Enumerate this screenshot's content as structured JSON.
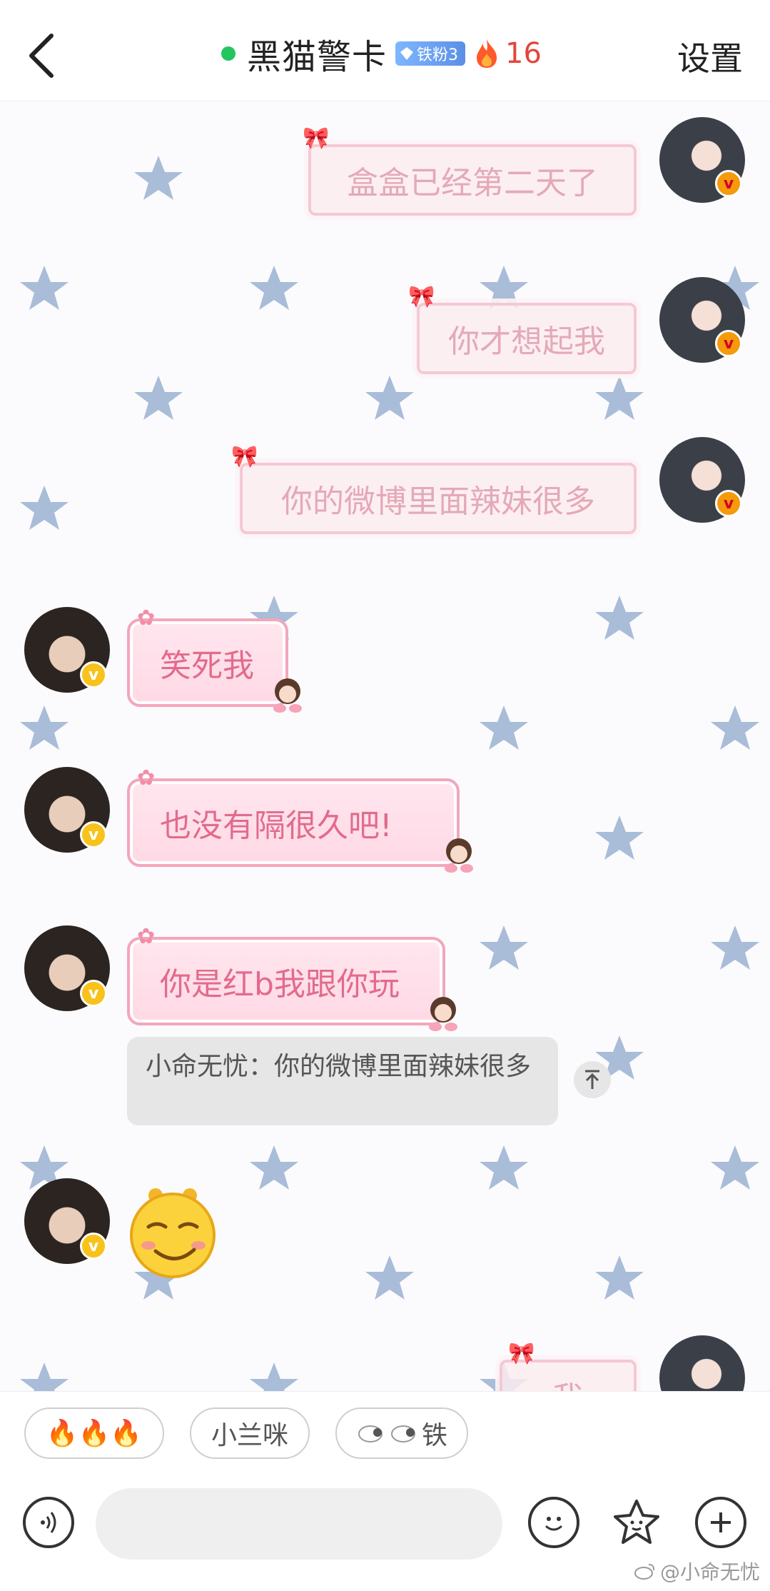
{
  "header": {
    "title": "黑猫警卡",
    "fan_badge": "铁粉3",
    "fire_count": "16",
    "settings_label": "设置"
  },
  "messages": {
    "out_1": "盒盒已经第二天了",
    "out_2": "你才想起我",
    "out_3": "你的微博里面辣妹很多",
    "in_1": "笑死我",
    "in_2": "也没有隔很久吧!",
    "in_3": "你是红b我跟你玩",
    "quote": "小命无忧：你的微博里面辣妹很多",
    "out_4_partial": "我"
  },
  "quick_replies": {
    "chip_1": "🔥🔥🔥",
    "chip_2": "小兰咪",
    "chip_3": "铁"
  },
  "input": {
    "placeholder": ""
  },
  "watermark": "@小命无忧",
  "colors": {
    "online": "#22c55e",
    "fire_text": "#e0463a",
    "bubble_in_text": "#e26b8d",
    "bubble_out_text": "#e4a9b8",
    "star": "#a9bcd8"
  }
}
